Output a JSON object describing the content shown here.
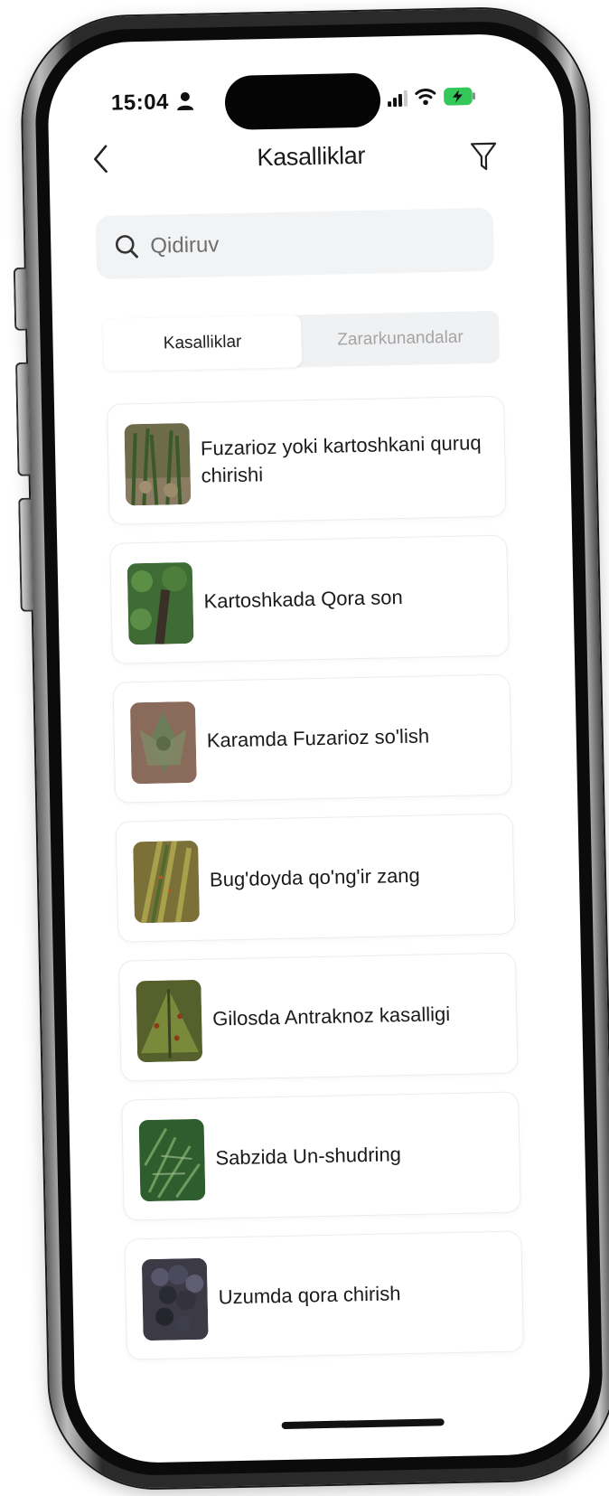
{
  "status_bar": {
    "time": "15:04",
    "icons": [
      "person-icon",
      "signal-icon",
      "wifi-icon",
      "battery-charging-icon"
    ],
    "battery_color": "#34c759"
  },
  "nav": {
    "title": "Kasalliklar",
    "back_icon": "chevron-left-icon",
    "filter_icon": "filter-icon"
  },
  "search": {
    "placeholder": "Qidiruv",
    "value": "",
    "icon": "search-icon"
  },
  "tabs": [
    {
      "label": "Kasalliklar",
      "active": true
    },
    {
      "label": "Zararkunandalar",
      "active": false
    }
  ],
  "items": [
    {
      "title": "Fuzarioz yoki kartoshkani quruq chirishi",
      "thumb_color": "#6d6b4a"
    },
    {
      "title": "Kartoshkada Qora son",
      "thumb_color": "#3f6b35"
    },
    {
      "title": "Karamda Fuzarioz so'lish",
      "thumb_color": "#8a6a5a"
    },
    {
      "title": "Bug'doyda qo'ng'ir zang",
      "thumb_color": "#7a7038"
    },
    {
      "title": "Gilosda Antraknoz kasalligi",
      "thumb_color": "#55602d"
    },
    {
      "title": "Sabzida Un-shudring",
      "thumb_color": "#2f5e2e"
    },
    {
      "title": "Uzumda qora chirish",
      "thumb_color": "#3b3a45"
    }
  ],
  "colors": {
    "background": "#ffffff",
    "card_border": "#ececec",
    "search_bg": "#f2f3f5",
    "inactive_tab": "#a5a5a5"
  }
}
